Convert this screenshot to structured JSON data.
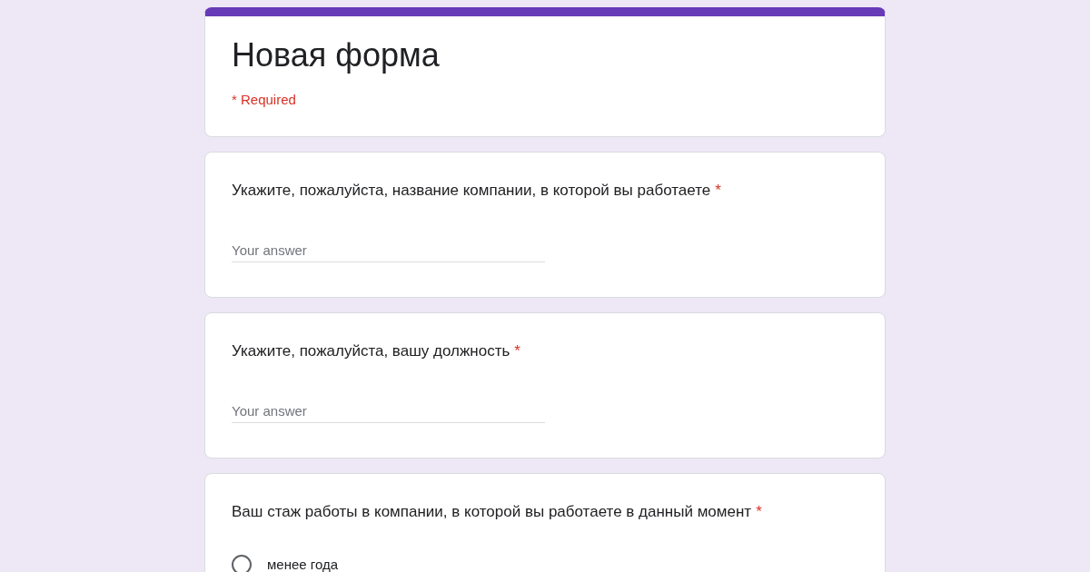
{
  "form": {
    "title": "Новая форма",
    "required_note": "* Required"
  },
  "questions": [
    {
      "kind": "text",
      "text": "Укажите, пожалуйста, название компании, в которой вы работаете",
      "asterisk": "*",
      "placeholder": "Your answer"
    },
    {
      "kind": "text",
      "text": "Укажите, пожалуйста, вашу должность",
      "asterisk": "*",
      "placeholder": "Your answer"
    },
    {
      "kind": "choice",
      "text": "Ваш стаж работы в компании, в которой вы работаете в данный момент",
      "asterisk": "*",
      "options": [
        {
          "label": "менее года",
          "selected": false
        }
      ]
    }
  ]
}
